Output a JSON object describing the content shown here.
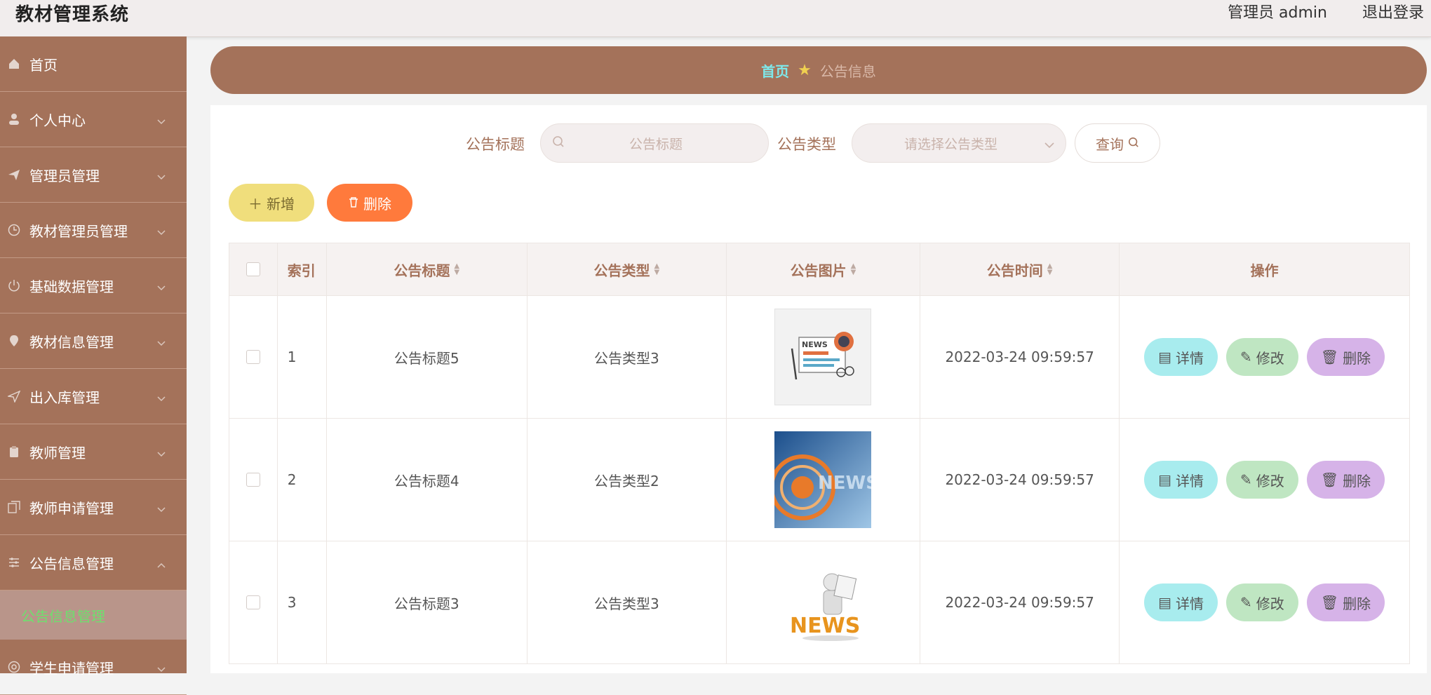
{
  "header": {
    "title": "教材管理系统",
    "user": "管理员 admin",
    "logout": "退出登录"
  },
  "sidebar": {
    "items": [
      {
        "label": "首页",
        "icon": "home-icon"
      },
      {
        "label": "个人中心",
        "icon": "user-icon"
      },
      {
        "label": "管理员管理",
        "icon": "send-icon"
      },
      {
        "label": "教材管理员管理",
        "icon": "clock-icon"
      },
      {
        "label": "基础数据管理",
        "icon": "power-icon"
      },
      {
        "label": "教材信息管理",
        "icon": "location-icon"
      },
      {
        "label": "出入库管理",
        "icon": "plane-icon"
      },
      {
        "label": "教师管理",
        "icon": "clipboard-icon"
      },
      {
        "label": "教师申请管理",
        "icon": "copy-icon"
      },
      {
        "label": "公告信息管理",
        "icon": "sliders-icon"
      }
    ],
    "active_sub": "公告信息管理",
    "after": {
      "label": "学生申请管理",
      "icon": "lifebuoy-icon"
    }
  },
  "breadcrumb": {
    "home": "首页",
    "current": "公告信息"
  },
  "search": {
    "title_label": "公告标题",
    "title_placeholder": "公告标题",
    "type_label": "公告类型",
    "type_placeholder": "请选择公告类型",
    "query_label": "查询"
  },
  "actions": {
    "add_label": "新增",
    "delete_label": "删除"
  },
  "table": {
    "headers": {
      "index": "索引",
      "title": "公告标题",
      "type": "公告类型",
      "image": "公告图片",
      "time": "公告时间",
      "ops": "操作"
    },
    "rows": [
      {
        "index": "1",
        "title": "公告标题5",
        "type": "公告类型3",
        "time": "2022-03-24 09:59:57"
      },
      {
        "index": "2",
        "title": "公告标题4",
        "type": "公告类型2",
        "time": "2022-03-24 09:59:57"
      },
      {
        "index": "3",
        "title": "公告标题3",
        "type": "公告类型3",
        "time": "2022-03-24 09:59:57"
      }
    ],
    "ops": {
      "detail": "详情",
      "edit": "修改",
      "delete": "删除"
    }
  },
  "colors": {
    "sidebar": "#a4725a",
    "accent_add": "#f0de7c",
    "accent_delete": "#ff7a3c",
    "detail": "#a8ecee",
    "edit": "#bfe6c2",
    "row_delete": "#d6b3e8"
  }
}
